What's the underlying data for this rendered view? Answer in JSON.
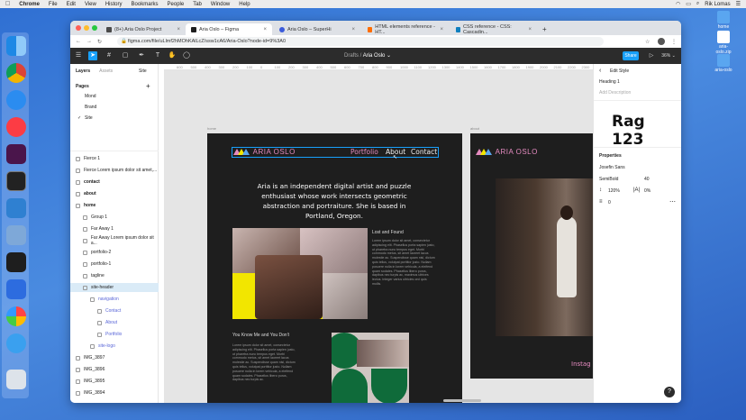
{
  "menubar": {
    "app": "Chrome",
    "items": [
      "File",
      "Edit",
      "View",
      "History",
      "Bookmarks",
      "People",
      "Tab",
      "Window",
      "Help"
    ],
    "clock": "Rik Lomas"
  },
  "desktop": {
    "files": [
      {
        "label": "home",
        "color": "#5aa6f0"
      },
      {
        "label": "aria-oslo.zip",
        "color": "#ffffff"
      },
      {
        "label": "aria-oslo",
        "color": "#5aa6f0"
      }
    ]
  },
  "browser": {
    "tabs": [
      {
        "label": "(8+) Aria Oslo Project",
        "fav": "#4a4a4a"
      },
      {
        "label": "Aria Oslo – Figma",
        "fav": "#1e1e1e",
        "active": true
      },
      {
        "label": "Aria Oslo – SuperHi",
        "fav": "#3b5bdb"
      },
      {
        "label": "HTML elements reference - HT...",
        "fav": "#ff6d00"
      },
      {
        "label": "CSS reference - CSS: Cascadin...",
        "fav": "#0f7fbf"
      }
    ],
    "url": "figma.com/file/uLlmf2hMOhKAlLcZ/ssw1cA6/Aria-Oslo?node-id=9%3A0"
  },
  "figma": {
    "breadcrumb_prefix": "Drafts /",
    "file_name": "Aria Oslo ⌄",
    "share_label": "Share",
    "zoom": "36% ⌄",
    "left_panel": {
      "tabs": [
        "Layers",
        "Assets"
      ],
      "page_tab": "Site",
      "pages_label": "Pages",
      "pages": [
        "Mond",
        "Brand",
        "Site"
      ],
      "layers": [
        {
          "label": "Fierce 1"
        },
        {
          "label": "Fierce Lorem ipsum dolor sit amet,..."
        },
        {
          "label": "contact",
          "bold": true
        },
        {
          "label": "about",
          "bold": true
        },
        {
          "label": "home",
          "bold": true
        },
        {
          "label": "Group 1"
        },
        {
          "label": "Far Away 1"
        },
        {
          "label": "Far Away Lorem ipsum dolor sit a..."
        },
        {
          "label": "portfolio-2"
        },
        {
          "label": "portfolio-1"
        },
        {
          "label": "tagline"
        },
        {
          "label": "site-header",
          "selected": true
        },
        {
          "label": "navigation"
        },
        {
          "label": "Contact"
        },
        {
          "label": "About"
        },
        {
          "label": "Portfolio"
        },
        {
          "label": "site-logo"
        },
        {
          "label": "IMG_3897"
        },
        {
          "label": "IMG_3896"
        },
        {
          "label": "IMG_3895"
        },
        {
          "label": "IMG_3894"
        }
      ]
    },
    "ruler": [
      "600",
      "500",
      "400",
      "300",
      "200",
      "100",
      "0",
      "100",
      "200",
      "300",
      "400",
      "500",
      "600",
      "700",
      "800",
      "900",
      "1000",
      "1100",
      "1200",
      "1300",
      "1400",
      "1500",
      "1600",
      "1700",
      "1800",
      "1900",
      "2000",
      "2100",
      "2200",
      "2300",
      "2400"
    ],
    "canvas": {
      "frame_home_label": "home",
      "frame_about_label": "about",
      "site_logo": "ARIA OSLO",
      "nav": [
        "Portfolio",
        "About",
        "Contact"
      ],
      "hero": "Aria is an independent digital artist and puzzle enthusiast whose work intersects geometric abstraction and portraiture. She is based in Portland, Oregon.",
      "section1_title": "Lost and Found",
      "section1_text": "Lorem ipsum dolor sit amet, consectetur adipiscing elit. Phasellus porta sapien justo, ut pharetra nunc tempus eget. Morbi commodo metus, sit amet laoreet lacus molestie ac. Suspendisse quam nisl, dictum quis tellus, volutpat porttitor justo. Nullam posuere nulla in lorem vehicula, a eleifend quam sodales. Phasellus libero purus, dapibus nec turpis ac, maximus ultrices lectus. Integer varius ultricies orci quis mollis.",
      "section2_title": "You Know Me and You Don't",
      "section2_text": "Lorem ipsum dolor sit amet, consectetur adipiscing elit. Phasellus porta sapien justo, ut pharetra nunc tempus eget. Morbi commodo metus, sit amet laoreet lacus molestie ac. Suspendisse quam nisl, dictum quis tellus, volutpat porttitor justo. Nullam posuere nulla in lorem vehicula, a eleifend quam sodales. Phasellus libero purus, dapibus nec turpis ac.",
      "about_logo": "ARIA OSLO",
      "about_footer": "Instag"
    },
    "right_panel": {
      "title": "Edit Style",
      "style_name": "Heading 1",
      "description_placeholder": "Add Description",
      "preview": "Rag 123",
      "properties_label": "Properties",
      "font_family": "Josefin Sans",
      "font_weight": "SemiBold",
      "font_size": "40",
      "line_height": "120%",
      "letter_spacing": "0%",
      "paragraph_spacing": "0"
    },
    "help_label": "?"
  },
  "colors": {
    "figma_blue": "#18a0fb",
    "pink": "#e58bc0",
    "yellow": "#f2e600",
    "green": "#0f6b3a"
  }
}
